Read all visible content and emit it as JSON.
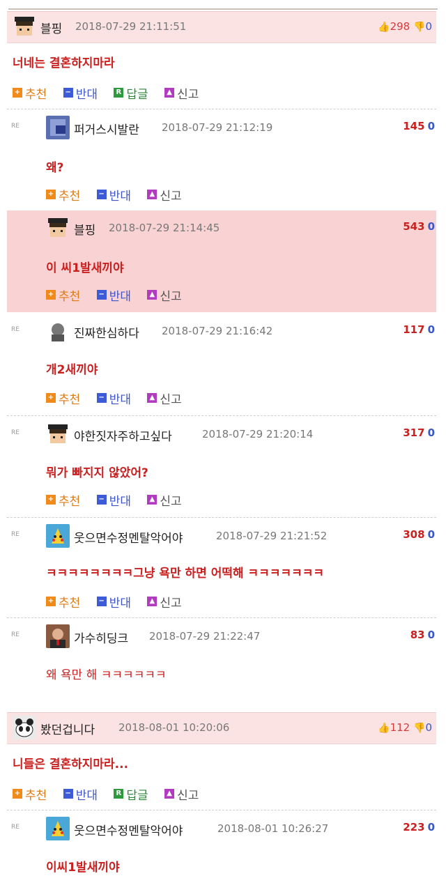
{
  "threads": [
    {
      "nick": "블핑",
      "date": "2018-07-29 21:11:51",
      "up": "298",
      "down": "0",
      "body": "너네는 결혼하지마라",
      "actions": {
        "recommend": "추천",
        "oppose": "반대",
        "reply": "답글",
        "report": "신고"
      },
      "replies": [
        {
          "re": "RE",
          "nick": "퍼거스시발란",
          "date": "2018-07-29 21:12:19",
          "up": "145",
          "down": "0",
          "body": "왜?",
          "highlight": false
        },
        {
          "re": "RE",
          "nick": "블핑",
          "date": "2018-07-29 21:14:45",
          "up": "543",
          "down": "0",
          "body": "이 씨1발새끼야",
          "highlight": true
        },
        {
          "re": "RE",
          "nick": "진짜한심하다",
          "date": "2018-07-29 21:16:42",
          "up": "117",
          "down": "0",
          "body": "개2새끼야",
          "highlight": false
        },
        {
          "re": "RE",
          "nick": "야한짓자주하고싶다",
          "date": "2018-07-29 21:20:14",
          "up": "317",
          "down": "0",
          "body": "뭐가 빠지지 않았어?",
          "highlight": false
        },
        {
          "re": "RE",
          "nick": "웃으면수정멘탈악어야",
          "date": "2018-07-29 21:21:52",
          "up": "308",
          "down": "0",
          "body": "ㅋㅋㅋㅋㅋㅋㅋㅋ그냥 욕만 하면 어떡해 ㅋㅋㅋㅋㅋㅋㅋ",
          "highlight": false
        },
        {
          "re": "RE",
          "nick": "가수히딩크",
          "date": "2018-07-29 21:22:47",
          "up": "83",
          "down": "0",
          "body": "왜 욕만 해 ㅋㅋㅋㅋㅋㅋ",
          "highlight": false
        }
      ]
    },
    {
      "nick": "봤던겁니다",
      "date": "2018-08-01 10:20:06",
      "up": "112",
      "down": "0",
      "body": "니들은 결혼하지마라...",
      "actions": {
        "recommend": "추천",
        "oppose": "반대",
        "reply": "답글",
        "report": "신고"
      },
      "replies": [
        {
          "re": "RE",
          "nick": "웃으면수정멘탈악어야",
          "date": "2018-08-01 10:26:27",
          "up": "223",
          "down": "0",
          "body": "이씨1발새끼야",
          "highlight": false
        }
      ]
    }
  ],
  "reply_actions": {
    "recommend": "추천",
    "oppose": "반대",
    "report": "신고"
  },
  "colors": {
    "header_bg": "#fbe3e3",
    "highlight_bg": "#f9d3d3",
    "accent_red": "#c92020",
    "accent_blue": "#3a57c9"
  }
}
